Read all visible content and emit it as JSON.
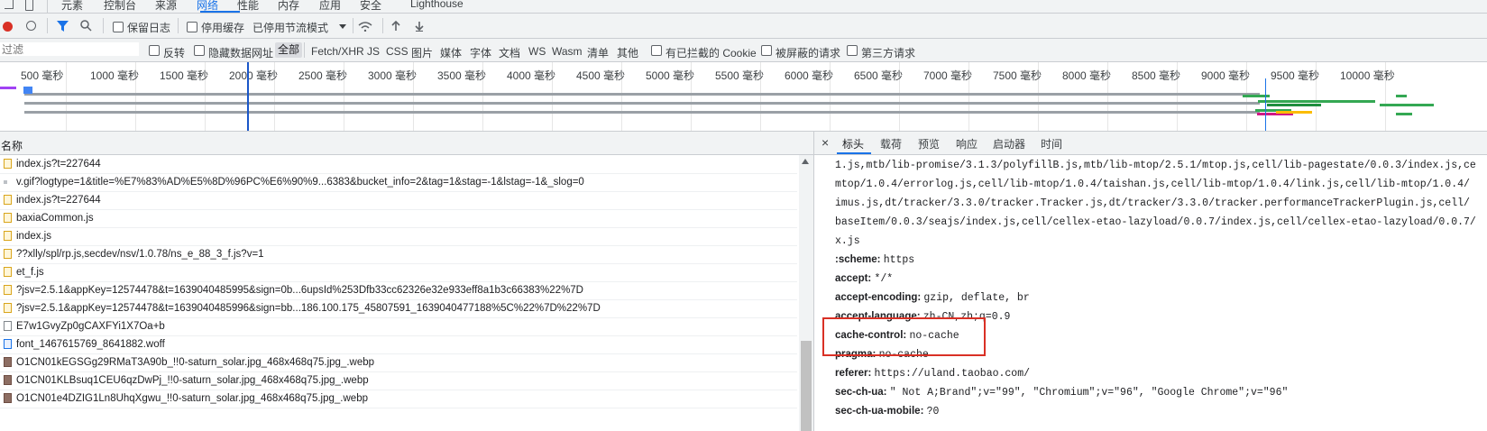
{
  "panel_tabs": [
    "元素",
    "控制台",
    "来源",
    "网络",
    "性能",
    "内存",
    "应用",
    "安全",
    "Lighthouse"
  ],
  "toolbar": {
    "preserve_log": "保留日志",
    "disable_cache": "停用缓存",
    "throttle": "已停用节流模式"
  },
  "filter": {
    "placeholder": "过滤",
    "invert": "反转",
    "hide_data_urls": "隐藏数据网址",
    "types": [
      "全部",
      "Fetch/XHR",
      "JS",
      "CSS",
      "图片",
      "媒体",
      "字体",
      "文档",
      "WS",
      "Wasm",
      "清单",
      "其他"
    ],
    "blocked_cookies": "有已拦截的 Cookie",
    "blocked_requests": "被屏蔽的请求",
    "third_party": "第三方请求"
  },
  "timeline_labels": [
    "500 毫秒",
    "1000 毫秒",
    "1500 毫秒",
    "2000 毫秒",
    "2500 毫秒",
    "3000 毫秒",
    "3500 毫秒",
    "4000 毫秒",
    "4500 毫秒",
    "5000 毫秒",
    "5500 毫秒",
    "6000 毫秒",
    "6500 毫秒",
    "7000 毫秒",
    "7500 毫秒",
    "8000 毫秒",
    "8500 毫秒",
    "9000 毫秒",
    "9500 毫秒",
    "10000 毫秒"
  ],
  "list": {
    "header": "名称",
    "rows": [
      "index.js?t=227644",
      "v.gif?logtype=1&title=%E7%83%AD%E5%8D%96PC%E6%90%9...6383&bucket_info=2&tag=1&stag=-1&lstag=-1&_slog=0",
      "index.js?t=227644",
      "baxiaCommon.js",
      "index.js",
      "??xlly/spl/rp.js,secdev/nsv/1.0.78/ns_e_88_3_f.js?v=1",
      "et_f.js",
      "?jsv=2.5.1&appKey=12574478&t=1639040485995&sign=0b...6upsId%253Dfb33cc62326e32e933eff8a1b3c66383%22%7D",
      "?jsv=2.5.1&appKey=12574478&t=1639040485996&sign=bb...186.100.175_45807591_1639040477188%5C%22%7D%22%7D",
      "E7w1GvyZp0gCAXFYi1X7Oa+b",
      "font_1467615769_8641882.woff",
      "O1CN01kEGSGg29RMaT3A90b_!!0-saturn_solar.jpg_468x468q75.jpg_.webp",
      "O1CN01KLBsuq1CEU6qzDwPj_!!0-saturn_solar.jpg_468x468q75.jpg_.webp",
      "O1CN01e4DZIG1Ln8UhqXgwu_!!0-saturn_solar.jpg_468x468q75.jpg_.webp"
    ]
  },
  "detail": {
    "close": "×",
    "tabs": [
      "标头",
      "载荷",
      "预览",
      "响应",
      "启动器",
      "时间"
    ],
    "lines": [
      {
        "name": "",
        "value": "1.js,mtb/lib-promise/3.1.3/polyfillB.js,mtb/lib-mtop/2.5.1/mtop.js,cell/lib-pagestate/0.0.3/index.js,ce"
      },
      {
        "name": "",
        "value": "mtop/1.0.4/errorlog.js,cell/lib-mtop/1.0.4/taishan.js,cell/lib-mtop/1.0.4/link.js,cell/lib-mtop/1.0.4/"
      },
      {
        "name": "",
        "value": "imus.js,dt/tracker/3.3.0/tracker.Tracker.js,dt/tracker/3.3.0/tracker.performanceTrackerPlugin.js,cell/"
      },
      {
        "name": "",
        "value": "baseItem/0.0.3/seajs/index.js,cell/cellex-etao-lazyload/0.0.7/index.js,cell/cellex-etao-lazyload/0.0.7/"
      },
      {
        "name": "",
        "value": "x.js"
      },
      {
        "name": ":scheme:",
        "value": "https"
      },
      {
        "name": "accept:",
        "value": "*/*"
      },
      {
        "name": "accept-encoding:",
        "value": "gzip, deflate, br"
      },
      {
        "name": "accept-language:",
        "value": "zh-CN,zh;q=0.9"
      },
      {
        "name": "cache-control:",
        "value": "no-cache"
      },
      {
        "name": "pragma:",
        "value": "no-cache"
      },
      {
        "name": "referer:",
        "value": "https://uland.taobao.com/"
      },
      {
        "name": "sec-ch-ua:",
        "value": "\" Not A;Brand\";v=\"99\", \"Chromium\";v=\"96\", \"Google Chrome\";v=\"96\""
      },
      {
        "name": "sec-ch-ua-mobile:",
        "value": "?0"
      }
    ]
  },
  "colors": {
    "accent": "#1a73e8",
    "record": "#d93025",
    "highlight_box": "#d93025"
  }
}
